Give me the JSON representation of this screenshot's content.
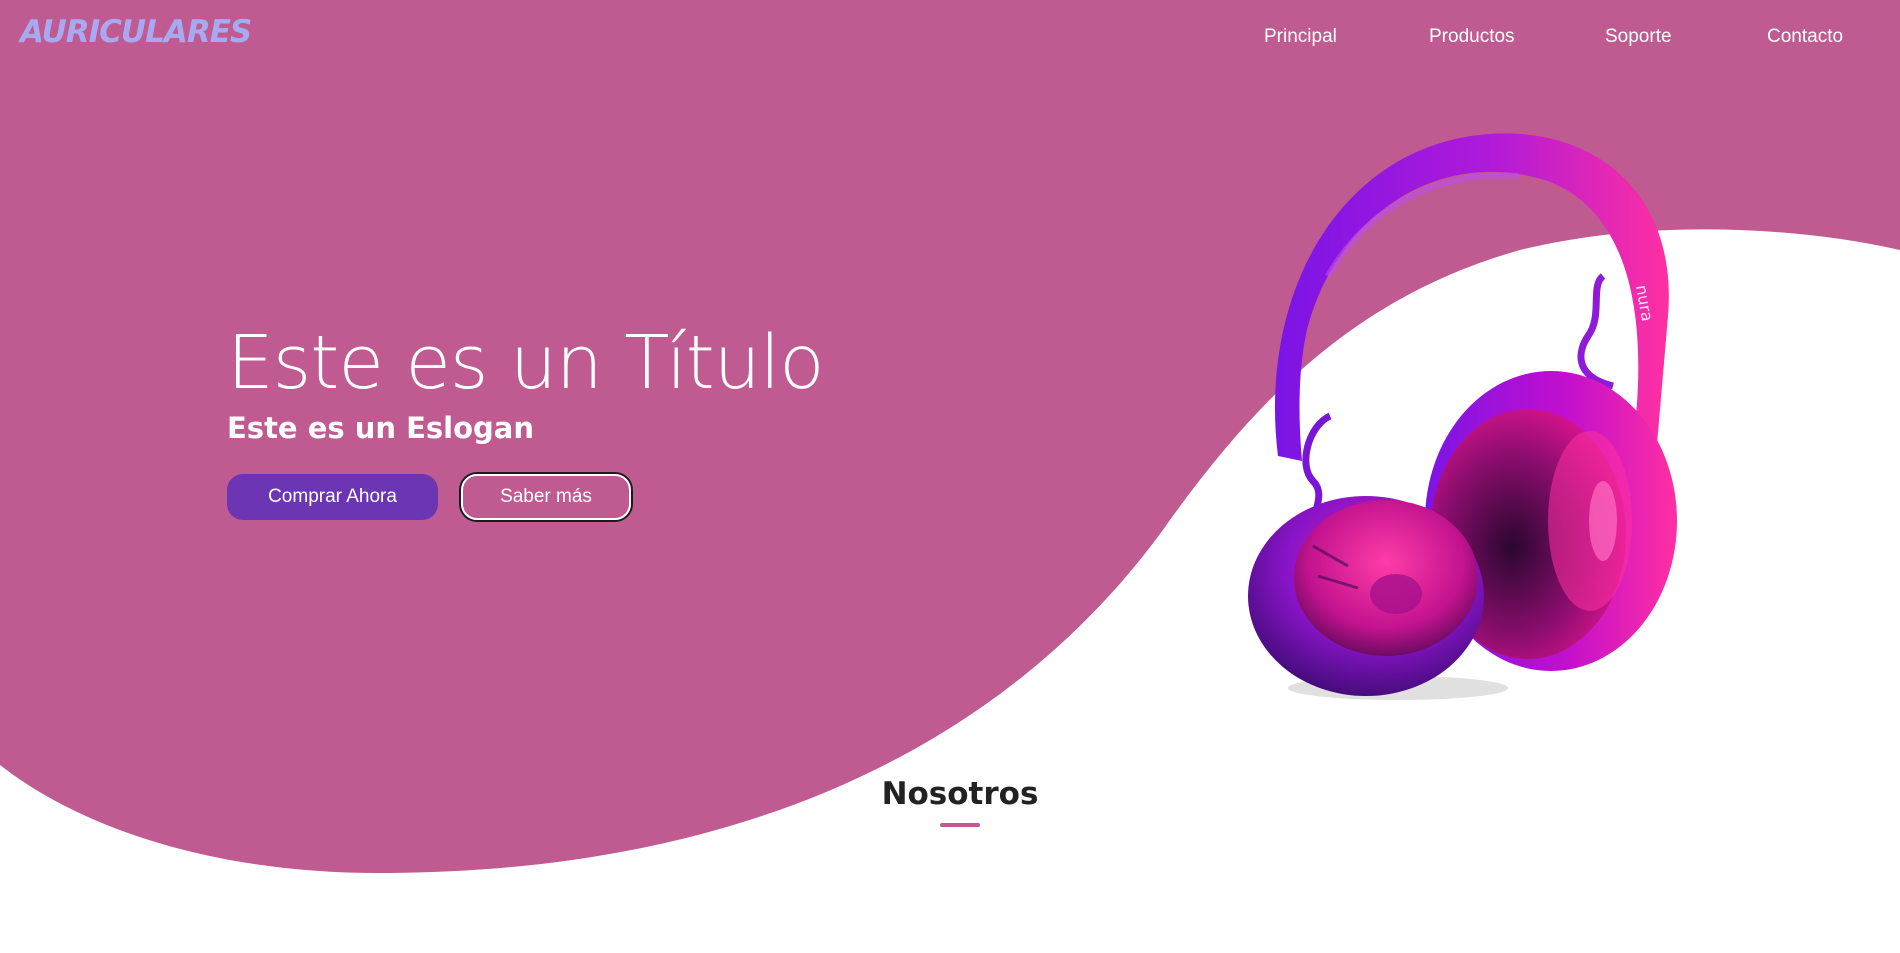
{
  "colors": {
    "primary_bg": "#bf5b91",
    "accent_purple": "#6c35b3",
    "logo": "#a9a9f2",
    "white": "#ffffff",
    "headphone_pink": "#ff2fa2",
    "headphone_purple": "#7b14e6"
  },
  "header": {
    "logo": "AURICULARES",
    "nav": [
      {
        "label": "Principal"
      },
      {
        "label": "Productos"
      },
      {
        "label": "Soporte"
      },
      {
        "label": "Contacto"
      }
    ]
  },
  "hero": {
    "title": "Este es un Título",
    "slogan": "Este es un Eslogan",
    "buttons": {
      "primary": "Comprar Ahora",
      "secondary": "Saber más"
    },
    "image_icon": "headphones-icon",
    "headphone_brand": "nura"
  },
  "about": {
    "title": "Nosotros"
  }
}
